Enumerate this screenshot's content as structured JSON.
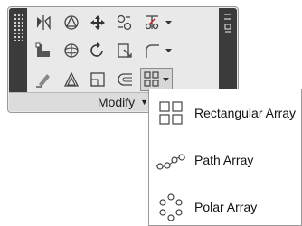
{
  "panel": {
    "title": "Modify",
    "tools": [
      {
        "name": "mirror-icon"
      },
      {
        "name": "rotate-3d-icon"
      },
      {
        "name": "move-icon"
      },
      {
        "name": "copy-icon"
      },
      {
        "name": "trim-icon"
      },
      {
        "name": "stretch-icon"
      },
      {
        "name": "fillet-3d-icon"
      },
      {
        "name": "rotate-icon"
      },
      {
        "name": "scale-icon"
      },
      {
        "name": "fillet-icon"
      },
      {
        "name": "erase-icon"
      },
      {
        "name": "align-icon"
      },
      {
        "name": "offset-rect-icon"
      },
      {
        "name": "offset-icon"
      },
      {
        "name": "array-icon"
      }
    ]
  },
  "menu": {
    "items": [
      {
        "label": "Rectangular Array",
        "icon": "rectangular-array-icon"
      },
      {
        "label": "Path Array",
        "icon": "path-array-icon"
      },
      {
        "label": "Polar Array",
        "icon": "polar-array-icon"
      }
    ]
  }
}
